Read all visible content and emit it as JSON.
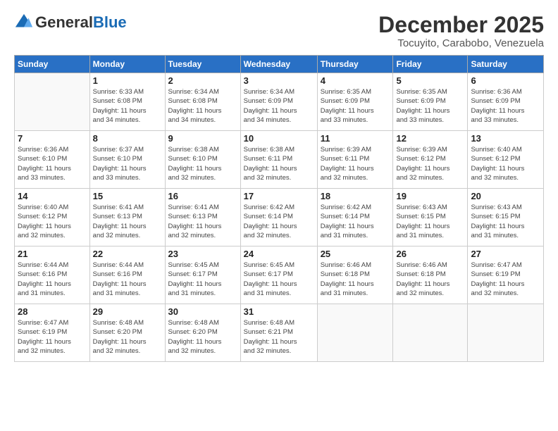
{
  "header": {
    "logo_general": "General",
    "logo_blue": "Blue",
    "month_title": "December 2025",
    "subtitle": "Tocuyito, Carabobo, Venezuela"
  },
  "weekdays": [
    "Sunday",
    "Monday",
    "Tuesday",
    "Wednesday",
    "Thursday",
    "Friday",
    "Saturday"
  ],
  "weeks": [
    [
      {
        "day": "",
        "info": ""
      },
      {
        "day": "1",
        "info": "Sunrise: 6:33 AM\nSunset: 6:08 PM\nDaylight: 11 hours\nand 34 minutes."
      },
      {
        "day": "2",
        "info": "Sunrise: 6:34 AM\nSunset: 6:08 PM\nDaylight: 11 hours\nand 34 minutes."
      },
      {
        "day": "3",
        "info": "Sunrise: 6:34 AM\nSunset: 6:09 PM\nDaylight: 11 hours\nand 34 minutes."
      },
      {
        "day": "4",
        "info": "Sunrise: 6:35 AM\nSunset: 6:09 PM\nDaylight: 11 hours\nand 33 minutes."
      },
      {
        "day": "5",
        "info": "Sunrise: 6:35 AM\nSunset: 6:09 PM\nDaylight: 11 hours\nand 33 minutes."
      },
      {
        "day": "6",
        "info": "Sunrise: 6:36 AM\nSunset: 6:09 PM\nDaylight: 11 hours\nand 33 minutes."
      }
    ],
    [
      {
        "day": "7",
        "info": "Sunrise: 6:36 AM\nSunset: 6:10 PM\nDaylight: 11 hours\nand 33 minutes."
      },
      {
        "day": "8",
        "info": "Sunrise: 6:37 AM\nSunset: 6:10 PM\nDaylight: 11 hours\nand 33 minutes."
      },
      {
        "day": "9",
        "info": "Sunrise: 6:38 AM\nSunset: 6:10 PM\nDaylight: 11 hours\nand 32 minutes."
      },
      {
        "day": "10",
        "info": "Sunrise: 6:38 AM\nSunset: 6:11 PM\nDaylight: 11 hours\nand 32 minutes."
      },
      {
        "day": "11",
        "info": "Sunrise: 6:39 AM\nSunset: 6:11 PM\nDaylight: 11 hours\nand 32 minutes."
      },
      {
        "day": "12",
        "info": "Sunrise: 6:39 AM\nSunset: 6:12 PM\nDaylight: 11 hours\nand 32 minutes."
      },
      {
        "day": "13",
        "info": "Sunrise: 6:40 AM\nSunset: 6:12 PM\nDaylight: 11 hours\nand 32 minutes."
      }
    ],
    [
      {
        "day": "14",
        "info": "Sunrise: 6:40 AM\nSunset: 6:12 PM\nDaylight: 11 hours\nand 32 minutes."
      },
      {
        "day": "15",
        "info": "Sunrise: 6:41 AM\nSunset: 6:13 PM\nDaylight: 11 hours\nand 32 minutes."
      },
      {
        "day": "16",
        "info": "Sunrise: 6:41 AM\nSunset: 6:13 PM\nDaylight: 11 hours\nand 32 minutes."
      },
      {
        "day": "17",
        "info": "Sunrise: 6:42 AM\nSunset: 6:14 PM\nDaylight: 11 hours\nand 32 minutes."
      },
      {
        "day": "18",
        "info": "Sunrise: 6:42 AM\nSunset: 6:14 PM\nDaylight: 11 hours\nand 31 minutes."
      },
      {
        "day": "19",
        "info": "Sunrise: 6:43 AM\nSunset: 6:15 PM\nDaylight: 11 hours\nand 31 minutes."
      },
      {
        "day": "20",
        "info": "Sunrise: 6:43 AM\nSunset: 6:15 PM\nDaylight: 11 hours\nand 31 minutes."
      }
    ],
    [
      {
        "day": "21",
        "info": "Sunrise: 6:44 AM\nSunset: 6:16 PM\nDaylight: 11 hours\nand 31 minutes."
      },
      {
        "day": "22",
        "info": "Sunrise: 6:44 AM\nSunset: 6:16 PM\nDaylight: 11 hours\nand 31 minutes."
      },
      {
        "day": "23",
        "info": "Sunrise: 6:45 AM\nSunset: 6:17 PM\nDaylight: 11 hours\nand 31 minutes."
      },
      {
        "day": "24",
        "info": "Sunrise: 6:45 AM\nSunset: 6:17 PM\nDaylight: 11 hours\nand 31 minutes."
      },
      {
        "day": "25",
        "info": "Sunrise: 6:46 AM\nSunset: 6:18 PM\nDaylight: 11 hours\nand 31 minutes."
      },
      {
        "day": "26",
        "info": "Sunrise: 6:46 AM\nSunset: 6:18 PM\nDaylight: 11 hours\nand 32 minutes."
      },
      {
        "day": "27",
        "info": "Sunrise: 6:47 AM\nSunset: 6:19 PM\nDaylight: 11 hours\nand 32 minutes."
      }
    ],
    [
      {
        "day": "28",
        "info": "Sunrise: 6:47 AM\nSunset: 6:19 PM\nDaylight: 11 hours\nand 32 minutes."
      },
      {
        "day": "29",
        "info": "Sunrise: 6:48 AM\nSunset: 6:20 PM\nDaylight: 11 hours\nand 32 minutes."
      },
      {
        "day": "30",
        "info": "Sunrise: 6:48 AM\nSunset: 6:20 PM\nDaylight: 11 hours\nand 32 minutes."
      },
      {
        "day": "31",
        "info": "Sunrise: 6:48 AM\nSunset: 6:21 PM\nDaylight: 11 hours\nand 32 minutes."
      },
      {
        "day": "",
        "info": ""
      },
      {
        "day": "",
        "info": ""
      },
      {
        "day": "",
        "info": ""
      }
    ]
  ]
}
